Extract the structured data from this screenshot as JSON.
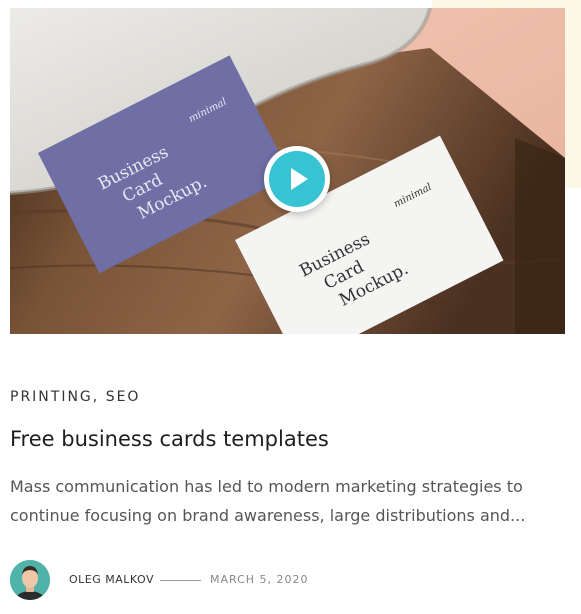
{
  "post": {
    "media": {
      "card_purple_text": "Business Card Mockup.",
      "card_white_text": "Business Card Mockup.",
      "card_script_text": "minimal",
      "play_icon": "play-icon"
    },
    "categories": [
      "PRINTING",
      "SEO"
    ],
    "category_separator": ", ",
    "title": "Free business cards templates",
    "excerpt": "Mass communication has led to modern marketing strategies to continue focusing on brand awareness, large distributions and...",
    "author": "OLEG MALKOV",
    "date": "MARCH 5, 2020"
  },
  "colors": {
    "accent": "#38c3d5",
    "card_purple": "#6f6ea5",
    "card_white": "#f4f4f2"
  }
}
